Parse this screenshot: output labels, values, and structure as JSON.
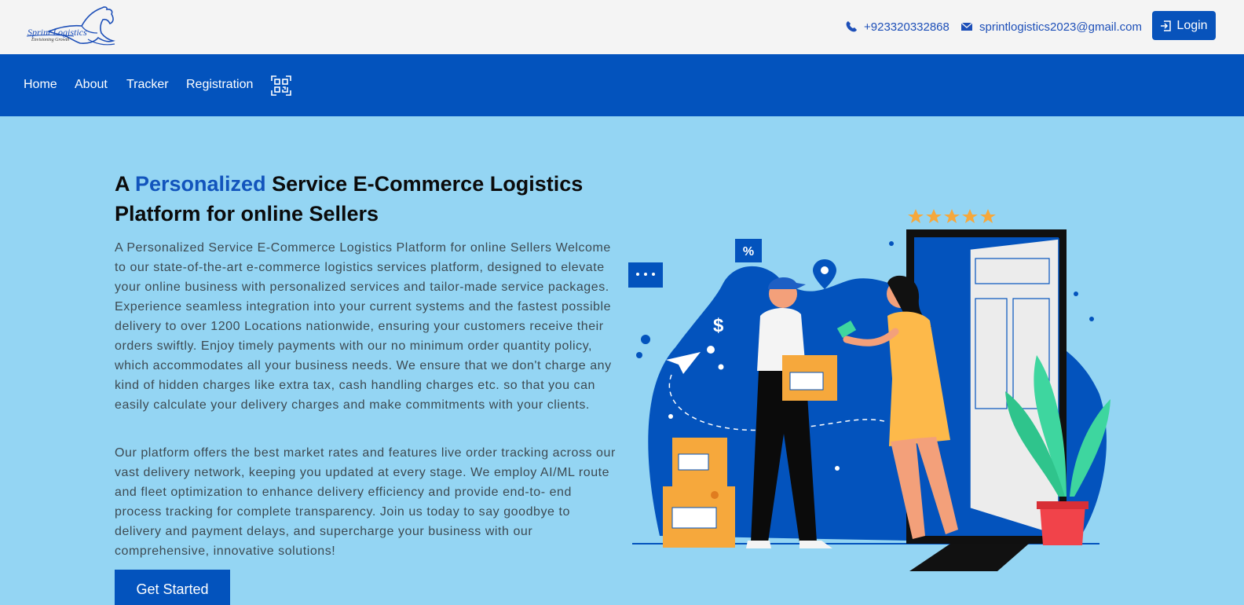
{
  "brand": {
    "name": "Sprint Logistics",
    "tagline": "Envisioning Growth"
  },
  "contact": {
    "phone": "+923320332868",
    "email": "sprintlogistics2023@gmail.com"
  },
  "header": {
    "login_label": "Login"
  },
  "nav": {
    "items": [
      {
        "label": "Home"
      },
      {
        "label": "About"
      },
      {
        "label": "Tracker"
      },
      {
        "label": "Registration"
      }
    ]
  },
  "hero": {
    "title_prefix": "A ",
    "title_highlight": "Personalized",
    "title_suffix": " Service E-Commerce Logistics Platform for online Sellers",
    "paragraph_1": "A Personalized Service E-Commerce Logistics Platform for online Sellers Welcome to our state-of-the-art e-commerce logistics services platform, designed to elevate your online business with personalized services and tailor-made service packages. Experience seamless integration into your current systems and the fastest possible delivery to over 1200 Locations nationwide, ensuring your customers receive their orders swiftly. Enjoy timely payments with our no minimum order quantity policy, which accommodates all your business needs. We ensure that we don't charge any kind of hidden charges like extra tax, cash handling charges etc. so that you can easily calculate your delivery charges and make commitments with your clients.",
    "paragraph_2": "Our platform offers the best market rates and features live order tracking across our vast delivery network, keeping you updated at every stage. We employ AI/ML route and fleet optimization to enhance delivery efficiency and provide end-to- end process tracking for complete transparency. Join us today to say goodbye to delivery and payment delays, and supercharge your business with our comprehensive, innovative solutions!",
    "cta_label": "Get Started"
  },
  "illustration": {
    "percent_badge": "%",
    "dollar_sign": "$",
    "rating_stars": 5
  },
  "icons": {
    "phone": "phone-icon",
    "email": "mail-icon",
    "login": "login-icon",
    "qr": "qr-code-icon"
  },
  "colors": {
    "brand_blue": "#0353bd",
    "hero_background": "#94d5f3",
    "topbar_background": "#f4f4f4",
    "title_highlight": "#1254bc",
    "star": "#f6a83c",
    "box": "#f6a83c"
  }
}
